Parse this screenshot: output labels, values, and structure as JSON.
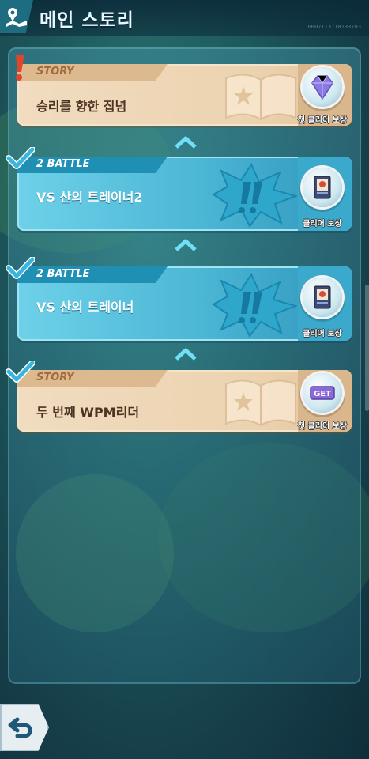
{
  "header": {
    "title": "메인 스토리",
    "meta": "0007113718133783"
  },
  "stages": [
    {
      "type": "STORY",
      "title": "승리를 향한 집념",
      "reward_label": "첫 클리어 보상",
      "status": "new",
      "reward_icon": "gem-icon"
    },
    {
      "type": "2 BATTLE",
      "title": "VS 산의 트레이너2",
      "reward_label": "클리어 보상",
      "status": "cleared",
      "reward_icon": "trainer-card-icon"
    },
    {
      "type": "2 BATTLE",
      "title": "VS 산의 트레이너",
      "reward_label": "클리어 보상",
      "status": "cleared",
      "reward_icon": "trainer-card-icon"
    },
    {
      "type": "STORY",
      "title": "두 번째 WPM리더",
      "reward_label": "첫 클리어 보상",
      "status": "cleared",
      "reward_icon": "get-badge-icon",
      "reward_badge": "GET"
    }
  ],
  "colors": {
    "story_card": "#ecd3b0",
    "battle_card": "#4cb6d5",
    "check": "#39b6e0",
    "alert": "#e0452d"
  }
}
